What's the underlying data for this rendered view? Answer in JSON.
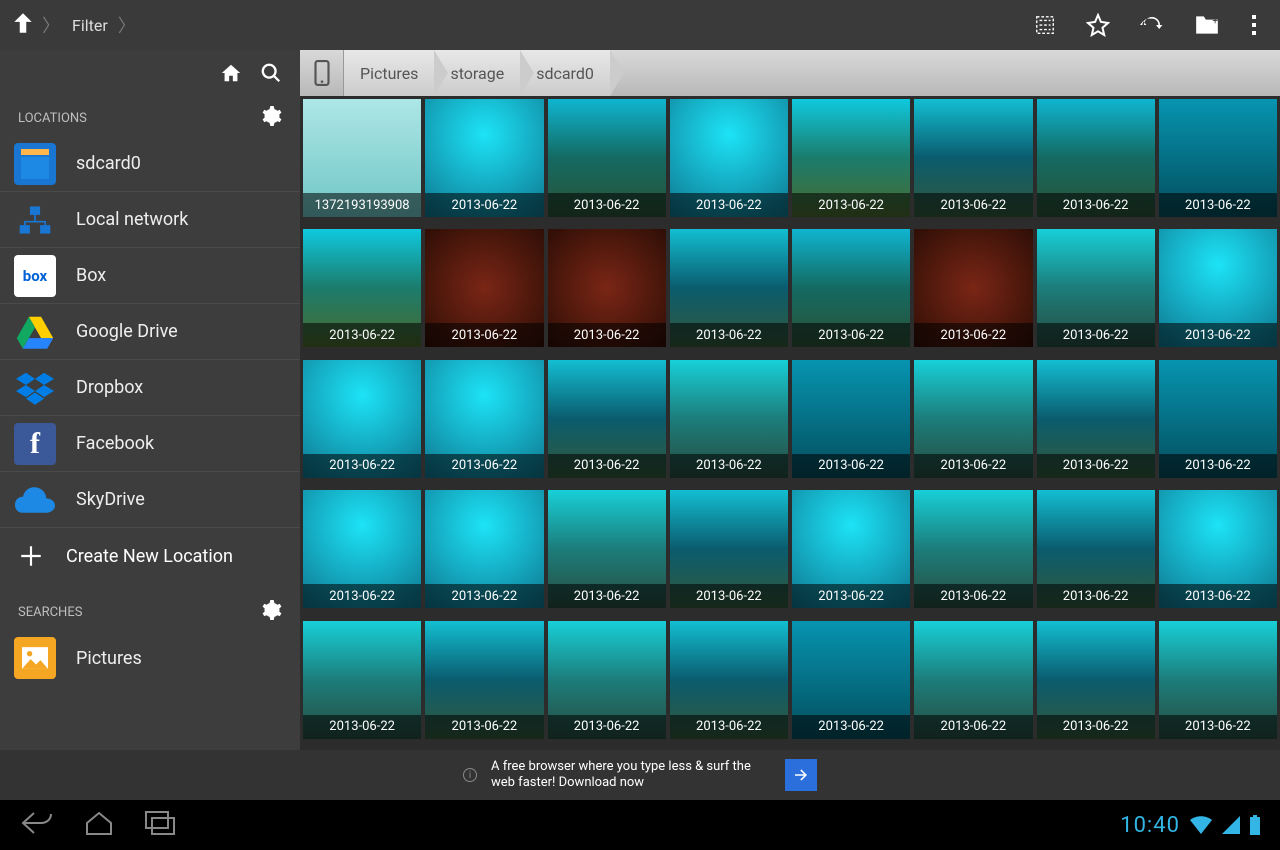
{
  "topbar": {
    "filter_label": "Filter"
  },
  "sidebar": {
    "section_locations": "LOCATIONS",
    "section_searches": "SEARCHES",
    "items": [
      {
        "label": "sdcard0",
        "icon": "sd-card"
      },
      {
        "label": "Local network",
        "icon": "network"
      },
      {
        "label": "Box",
        "icon": "box"
      },
      {
        "label": "Google Drive",
        "icon": "google-drive"
      },
      {
        "label": "Dropbox",
        "icon": "dropbox"
      },
      {
        "label": "Facebook",
        "icon": "facebook"
      },
      {
        "label": "SkyDrive",
        "icon": "skydrive"
      }
    ],
    "create_label": "Create New Location",
    "searches": [
      {
        "label": "Pictures",
        "icon": "pictures"
      }
    ]
  },
  "path": {
    "crumbs": [
      "Pictures",
      "storage",
      "sdcard0"
    ]
  },
  "grid": {
    "items": [
      {
        "caption": "1372193193908",
        "palette": "pA"
      },
      {
        "caption": "2013-06-22",
        "palette": "pB"
      },
      {
        "caption": "2013-06-22",
        "palette": "pC"
      },
      {
        "caption": "2013-06-22",
        "palette": "pB"
      },
      {
        "caption": "2013-06-22",
        "palette": "pD"
      },
      {
        "caption": "2013-06-22",
        "palette": "pG"
      },
      {
        "caption": "2013-06-22",
        "palette": "pC"
      },
      {
        "caption": "2013-06-22",
        "palette": "pF"
      },
      {
        "caption": "2013-06-22",
        "palette": "pD"
      },
      {
        "caption": "2013-06-22",
        "palette": "pE"
      },
      {
        "caption": "2013-06-22",
        "palette": "pE"
      },
      {
        "caption": "2013-06-22",
        "palette": "pG"
      },
      {
        "caption": "2013-06-22",
        "palette": "pC"
      },
      {
        "caption": "2013-06-22",
        "palette": "pE"
      },
      {
        "caption": "2013-06-22",
        "palette": "pH"
      },
      {
        "caption": "2013-06-22",
        "palette": "pB"
      },
      {
        "caption": "2013-06-22",
        "palette": "pB"
      },
      {
        "caption": "2013-06-22",
        "palette": "pB"
      },
      {
        "caption": "2013-06-22",
        "palette": "pG"
      },
      {
        "caption": "2013-06-22",
        "palette": "pH"
      },
      {
        "caption": "2013-06-22",
        "palette": "pF"
      },
      {
        "caption": "2013-06-22",
        "palette": "pH"
      },
      {
        "caption": "2013-06-22",
        "palette": "pG"
      },
      {
        "caption": "2013-06-22",
        "palette": "pF"
      },
      {
        "caption": "2013-06-22",
        "palette": "pB"
      },
      {
        "caption": "2013-06-22",
        "palette": "pB"
      },
      {
        "caption": "2013-06-22",
        "palette": "pH"
      },
      {
        "caption": "2013-06-22",
        "palette": "pG"
      },
      {
        "caption": "2013-06-22",
        "palette": "pB"
      },
      {
        "caption": "2013-06-22",
        "palette": "pH"
      },
      {
        "caption": "2013-06-22",
        "palette": "pG"
      },
      {
        "caption": "2013-06-22",
        "palette": "pB"
      },
      {
        "caption": "2013-06-22",
        "palette": "pH"
      },
      {
        "caption": "2013-06-22",
        "palette": "pG"
      },
      {
        "caption": "2013-06-22",
        "palette": "pH"
      },
      {
        "caption": "2013-06-22",
        "palette": "pG"
      },
      {
        "caption": "2013-06-22",
        "palette": "pF"
      },
      {
        "caption": "2013-06-22",
        "palette": "pH"
      },
      {
        "caption": "2013-06-22",
        "palette": "pG"
      },
      {
        "caption": "2013-06-22",
        "palette": "pH"
      }
    ]
  },
  "ad": {
    "text": "A free browser where you type less & surf the web faster! Download now"
  },
  "sysbar": {
    "clock": "10:40"
  }
}
